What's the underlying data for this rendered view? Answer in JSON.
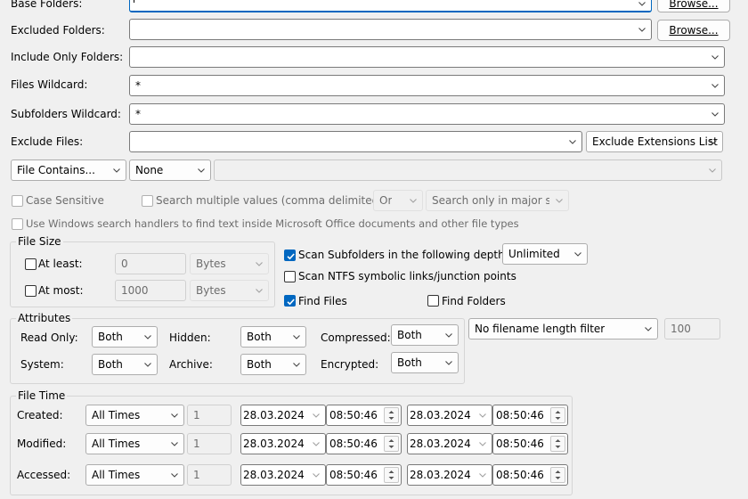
{
  "base_folders": {
    "label": "Base Folders:",
    "value": "",
    "browse": "Browse..."
  },
  "excluded_folders": {
    "label": "Excluded Folders:",
    "value": "",
    "browse": "Browse..."
  },
  "include_only_folders": {
    "label": "Include Only Folders:",
    "value": ""
  },
  "files_wildcard": {
    "label": "Files Wildcard:",
    "value": "*"
  },
  "subfolders_wildcard": {
    "label": "Subfolders Wildcard:",
    "value": "*"
  },
  "exclude_files": {
    "label": "Exclude Files:",
    "value": "",
    "mode": "Exclude Extensions List"
  },
  "file_contains": {
    "mode": "File Contains...",
    "encoding": "None",
    "value": ""
  },
  "options": {
    "case_sensitive": "Case Sensitive",
    "search_multiple": "Search multiple values (comma delimited)",
    "or_value": "Or",
    "streams": "Search only in major stre",
    "windows_handlers": "Use Windows search handlers to find text inside Microsoft Office documents and other file types"
  },
  "file_size": {
    "title": "File Size",
    "at_least": {
      "label": "At least:",
      "value": "0",
      "unit": "Bytes"
    },
    "at_most": {
      "label": "At most:",
      "value": "1000",
      "unit": "Bytes"
    }
  },
  "scan": {
    "subfolders_label": "Scan Subfolders in the following depth:",
    "subfolders_checked": true,
    "depth": "Unlimited",
    "ntfs_label": "Scan NTFS symbolic links/junction points",
    "ntfs_checked": false,
    "find_files_label": "Find Files",
    "find_files_checked": true,
    "find_folders_label": "Find Folders",
    "find_folders_checked": false
  },
  "attributes": {
    "title": "Attributes",
    "read_only": {
      "label": "Read Only:",
      "value": "Both"
    },
    "hidden": {
      "label": "Hidden:",
      "value": "Both"
    },
    "compressed": {
      "label": "Compressed:",
      "value": "Both"
    },
    "system": {
      "label": "System:",
      "value": "Both"
    },
    "archive": {
      "label": "Archive:",
      "value": "Both"
    },
    "encrypted": {
      "label": "Encrypted:",
      "value": "Both"
    }
  },
  "filename_length": {
    "mode": "No filename length filter",
    "value": "100"
  },
  "file_time": {
    "title": "File Time",
    "rows": [
      {
        "label": "Created:",
        "mode": "All Times",
        "count": "1",
        "date1": "28.03.2024",
        "time1": "08:50:46",
        "date2": "28.03.2024",
        "time2": "08:50:46"
      },
      {
        "label": "Modified:",
        "mode": "All Times",
        "count": "1",
        "date1": "28.03.2024",
        "time1": "08:50:46",
        "date2": "28.03.2024",
        "time2": "08:50:46"
      },
      {
        "label": "Accessed:",
        "mode": "All Times",
        "count": "1",
        "date1": "28.03.2024",
        "time1": "08:50:46",
        "date2": "28.03.2024",
        "time2": "08:50:46"
      }
    ]
  },
  "colors": {
    "accent": "#0067c0",
    "window_bg": "#f0f0f0",
    "field_border": "#7a7a7a"
  }
}
